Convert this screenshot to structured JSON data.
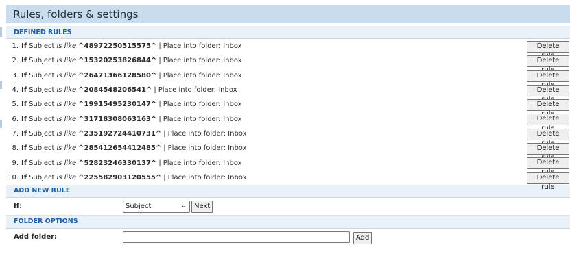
{
  "header": {
    "title": "Rules, folders & settings"
  },
  "defined_rules": {
    "heading": "DEFINED RULES",
    "delete_label": "Delete rule",
    "items": [
      {
        "num": "1.",
        "kw": "If",
        "field": "Subject",
        "op": "is like",
        "pattern": "^48972250515575^",
        "sep": "|",
        "action": "Place into folder: Inbox"
      },
      {
        "num": "2.",
        "kw": "If",
        "field": "Subject",
        "op": "is like",
        "pattern": "^15320253826844^",
        "sep": "|",
        "action": "Place into folder: Inbox"
      },
      {
        "num": "3.",
        "kw": "If",
        "field": "Subject",
        "op": "is like",
        "pattern": "^26471366128580^",
        "sep": "|",
        "action": "Place into folder: Inbox"
      },
      {
        "num": "4.",
        "kw": "If",
        "field": "Subject",
        "op": "is like",
        "pattern": "^2084548206541^",
        "sep": "|",
        "action": "Place into folder: Inbox"
      },
      {
        "num": "5.",
        "kw": "If",
        "field": "Subject",
        "op": "is like",
        "pattern": "^19915495230147^",
        "sep": "|",
        "action": "Place into folder: Inbox"
      },
      {
        "num": "6.",
        "kw": "If",
        "field": "Subject",
        "op": "is like",
        "pattern": "^31718308063163^",
        "sep": "|",
        "action": "Place into folder: Inbox"
      },
      {
        "num": "7.",
        "kw": "If",
        "field": "Subject",
        "op": "is like",
        "pattern": "^235192724410731^",
        "sep": "|",
        "action": "Place into folder: Inbox"
      },
      {
        "num": "8.",
        "kw": "If",
        "field": "Subject",
        "op": "is like",
        "pattern": "^285412654412485^",
        "sep": "|",
        "action": "Place into folder: Inbox"
      },
      {
        "num": "9.",
        "kw": "If",
        "field": "Subject",
        "op": "is like",
        "pattern": "^52823246330137^",
        "sep": "|",
        "action": "Place into folder: Inbox"
      },
      {
        "num": "10.",
        "kw": "If",
        "field": "Subject",
        "op": "is like",
        "pattern": "^225582903120555^",
        "sep": "|",
        "action": "Place into folder: Inbox"
      }
    ]
  },
  "add_new_rule": {
    "heading": "ADD NEW RULE",
    "if_label": "If:",
    "select_value": "Subject",
    "next_label": "Next"
  },
  "folder_options": {
    "heading": "FOLDER OPTIONS",
    "add_folder_label": "Add folder:",
    "input_value": "",
    "add_label": "Add"
  }
}
